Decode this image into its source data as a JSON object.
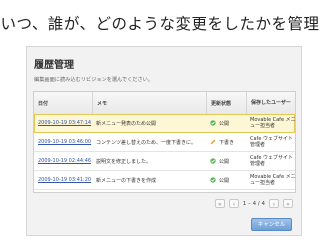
{
  "slide": {
    "title": "いつ、誰が、どのような変更をしたかを管理"
  },
  "dialog": {
    "title": "履歴管理",
    "subtitle": "編集画面に読み込むリビジョンを選んでください。",
    "columns": {
      "date": "日付",
      "memo": "メモ",
      "status": "更新状態",
      "saver": "保存したユーザー"
    },
    "rows": [
      {
        "date": "2009-10-19 03:47:14",
        "memo": "新メニュー発表のため公開",
        "status": "公開",
        "saver": "Movable Cafe メニュー担当者",
        "selected": true,
        "status_icon": "published-check-icon"
      },
      {
        "date": "2009-10-19 03:46:00",
        "memo": "コンテンツ差し替えのため、一度下書きに。",
        "status": "下書き",
        "saver": "Cafe ウェブサイト管理者",
        "selected": false,
        "status_icon": "draft-pencil-icon"
      },
      {
        "date": "2009-10-19 02:44:46",
        "memo": "説明文を修正しました。",
        "status": "公開",
        "saver": "Cafe ウェブサイト管理者",
        "selected": false,
        "status_icon": "published-check-icon"
      },
      {
        "date": "2009-10-19 03:41:20",
        "memo": "新メニューの下書きを作成",
        "status": "公開",
        "saver": "Movable Cafe メニュー担当者",
        "selected": false,
        "status_icon": "published-check-icon"
      }
    ],
    "pagination": {
      "first": "«",
      "prev": "‹",
      "range": "1 – 4 / 4",
      "next": "›",
      "last": "»"
    },
    "cancel_label": "キャンセル"
  },
  "colors": {
    "selected_row": "#fdf7d6",
    "published": "#5cb85c",
    "draft": "#f0a830",
    "link": "#3355aa",
    "primary_button": "#6e9fd6"
  }
}
